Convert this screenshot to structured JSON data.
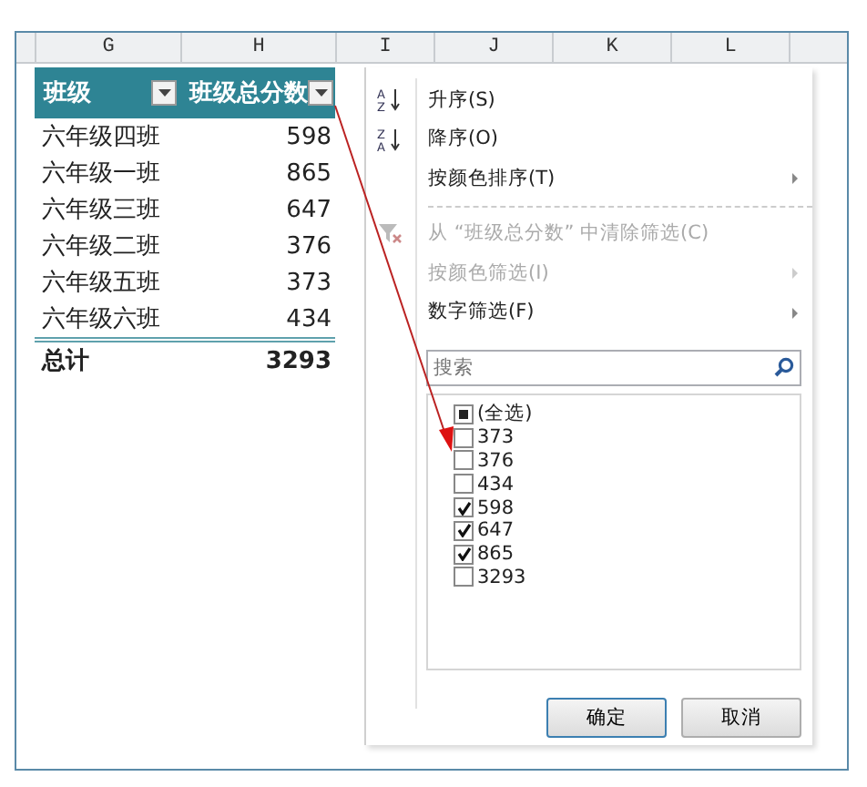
{
  "columns": [
    "G",
    "H",
    "I",
    "J",
    "K",
    "L"
  ],
  "table": {
    "headers": [
      {
        "label": "班级"
      },
      {
        "label": "班级总分数"
      }
    ],
    "rows": [
      {
        "name": "六年级四班",
        "score": "598"
      },
      {
        "name": "六年级一班",
        "score": "865"
      },
      {
        "name": "六年级三班",
        "score": "647"
      },
      {
        "name": "六年级二班",
        "score": "376"
      },
      {
        "name": "六年级五班",
        "score": "373"
      },
      {
        "name": "六年级六班",
        "score": "434"
      }
    ],
    "total": {
      "label": "总计",
      "value": "3293"
    }
  },
  "menu": {
    "items": [
      {
        "kind": "sort",
        "icon_letters": [
          "A",
          "Z"
        ],
        "label": "升序(S)",
        "disabled": false,
        "submenu": false
      },
      {
        "kind": "sort",
        "icon_letters": [
          "Z",
          "A"
        ],
        "label": "降序(O)",
        "disabled": false,
        "submenu": false
      },
      {
        "kind": "plain",
        "label": "按颜色排序(T)",
        "disabled": false,
        "submenu": true
      },
      {
        "kind": "separator"
      },
      {
        "kind": "clear",
        "label": "从 “班级总分数” 中清除筛选(C)",
        "disabled": true,
        "submenu": false
      },
      {
        "kind": "plain",
        "label": "按颜色筛选(I)",
        "disabled": true,
        "submenu": true
      },
      {
        "kind": "plain",
        "label": "数字筛选(F)",
        "disabled": false,
        "submenu": true
      }
    ],
    "search": {
      "placeholder": "搜索"
    },
    "values": [
      {
        "label": "(全选)",
        "checked": true,
        "partial": true
      },
      {
        "label": "373",
        "checked": false,
        "partial": false
      },
      {
        "label": "376",
        "checked": false,
        "partial": false
      },
      {
        "label": "434",
        "checked": false,
        "partial": false
      },
      {
        "label": "598",
        "checked": true,
        "partial": false
      },
      {
        "label": "647",
        "checked": true,
        "partial": false
      },
      {
        "label": "865",
        "checked": true,
        "partial": false
      },
      {
        "label": "3293",
        "checked": false,
        "partial": false
      }
    ],
    "buttons": [
      {
        "label": "确定",
        "default": true
      },
      {
        "label": "取消",
        "default": false
      }
    ]
  }
}
